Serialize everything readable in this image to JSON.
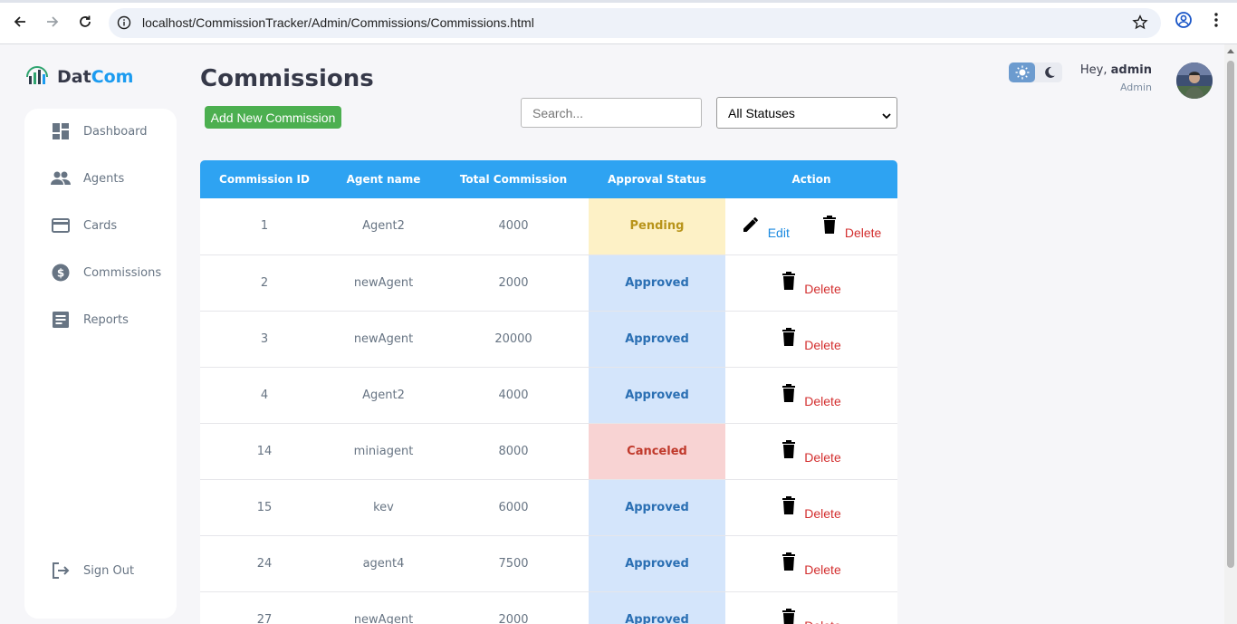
{
  "browser": {
    "url": "localhost/CommissionTracker/Admin/Commissions/Commissions.html",
    "icons": [
      "back-icon",
      "forward-icon",
      "reload-icon",
      "site-info-icon",
      "bookmark-star-icon",
      "profile-icon",
      "menu-dots-icon"
    ]
  },
  "brand": {
    "name_part1": "Dat",
    "name_part2": "Com",
    "accent": "#1b9bf0"
  },
  "sidebar": {
    "items": [
      {
        "label": "Dashboard",
        "icon": "dashboard-icon"
      },
      {
        "label": "Agents",
        "icon": "people-icon"
      },
      {
        "label": "Cards",
        "icon": "card-icon"
      },
      {
        "label": "Commissions",
        "icon": "dollar-icon"
      },
      {
        "label": "Reports",
        "icon": "report-icon"
      }
    ],
    "signout": {
      "label": "Sign Out",
      "icon": "logout-icon"
    }
  },
  "header": {
    "title": "Commissions",
    "add_button": "Add New Commission",
    "search_placeholder": "Search...",
    "status_filter": "All Statuses"
  },
  "user": {
    "greeting": "Hey,",
    "name": "admin",
    "role": "Admin"
  },
  "table": {
    "columns": [
      "Commission ID",
      "Agent name",
      "Total Commission",
      "Approval Status",
      "Action"
    ],
    "edit_label": "Edit",
    "delete_label": "Delete",
    "rows": [
      {
        "id": "1",
        "agent": "Agent2",
        "total": "4000",
        "status": "Pending",
        "status_type": "pending",
        "editable": true
      },
      {
        "id": "2",
        "agent": "newAgent",
        "total": "2000",
        "status": "Approved",
        "status_type": "approved",
        "editable": false
      },
      {
        "id": "3",
        "agent": "newAgent",
        "total": "20000",
        "status": "Approved",
        "status_type": "approved",
        "editable": false
      },
      {
        "id": "4",
        "agent": "Agent2",
        "total": "4000",
        "status": "Approved",
        "status_type": "approved",
        "editable": false
      },
      {
        "id": "14",
        "agent": "miniagent",
        "total": "8000",
        "status": "Canceled",
        "status_type": "canceled",
        "editable": false
      },
      {
        "id": "15",
        "agent": "kev",
        "total": "6000",
        "status": "Approved",
        "status_type": "approved",
        "editable": false
      },
      {
        "id": "24",
        "agent": "agent4",
        "total": "7500",
        "status": "Approved",
        "status_type": "approved",
        "editable": false
      },
      {
        "id": "27",
        "agent": "newAgent",
        "total": "2000",
        "status": "Approved",
        "status_type": "approved",
        "editable": false
      }
    ]
  },
  "colors": {
    "header_bg": "#2ea3f2",
    "add_button": "#4caf50",
    "pending_bg": "#fdf1c6",
    "approved_bg": "#d4e5fb",
    "canceled_bg": "#f8d3d3"
  }
}
